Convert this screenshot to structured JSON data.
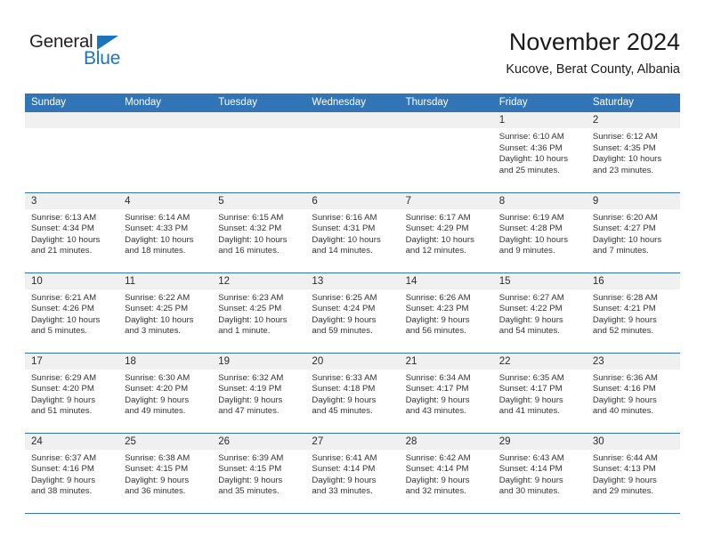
{
  "brand": {
    "name_part1": "General",
    "name_part2": "Blue",
    "accent_color": "#1b75bc"
  },
  "header": {
    "title": "November 2024",
    "subtitle": "Kucove, Berat County, Albania"
  },
  "theme": {
    "header_bg": "#3275b7",
    "daynum_bg": "#f0f0f0",
    "text_color": "#333333"
  },
  "weekdays": [
    "Sunday",
    "Monday",
    "Tuesday",
    "Wednesday",
    "Thursday",
    "Friday",
    "Saturday"
  ],
  "weeks": [
    [
      {
        "day": "",
        "empty": true
      },
      {
        "day": "",
        "empty": true
      },
      {
        "day": "",
        "empty": true
      },
      {
        "day": "",
        "empty": true
      },
      {
        "day": "",
        "empty": true
      },
      {
        "day": "1",
        "sunrise": "Sunrise: 6:10 AM",
        "sunset": "Sunset: 4:36 PM",
        "daylight1": "Daylight: 10 hours",
        "daylight2": "and 25 minutes."
      },
      {
        "day": "2",
        "sunrise": "Sunrise: 6:12 AM",
        "sunset": "Sunset: 4:35 PM",
        "daylight1": "Daylight: 10 hours",
        "daylight2": "and 23 minutes."
      }
    ],
    [
      {
        "day": "3",
        "sunrise": "Sunrise: 6:13 AM",
        "sunset": "Sunset: 4:34 PM",
        "daylight1": "Daylight: 10 hours",
        "daylight2": "and 21 minutes."
      },
      {
        "day": "4",
        "sunrise": "Sunrise: 6:14 AM",
        "sunset": "Sunset: 4:33 PM",
        "daylight1": "Daylight: 10 hours",
        "daylight2": "and 18 minutes."
      },
      {
        "day": "5",
        "sunrise": "Sunrise: 6:15 AM",
        "sunset": "Sunset: 4:32 PM",
        "daylight1": "Daylight: 10 hours",
        "daylight2": "and 16 minutes."
      },
      {
        "day": "6",
        "sunrise": "Sunrise: 6:16 AM",
        "sunset": "Sunset: 4:31 PM",
        "daylight1": "Daylight: 10 hours",
        "daylight2": "and 14 minutes."
      },
      {
        "day": "7",
        "sunrise": "Sunrise: 6:17 AM",
        "sunset": "Sunset: 4:29 PM",
        "daylight1": "Daylight: 10 hours",
        "daylight2": "and 12 minutes."
      },
      {
        "day": "8",
        "sunrise": "Sunrise: 6:19 AM",
        "sunset": "Sunset: 4:28 PM",
        "daylight1": "Daylight: 10 hours",
        "daylight2": "and 9 minutes."
      },
      {
        "day": "9",
        "sunrise": "Sunrise: 6:20 AM",
        "sunset": "Sunset: 4:27 PM",
        "daylight1": "Daylight: 10 hours",
        "daylight2": "and 7 minutes."
      }
    ],
    [
      {
        "day": "10",
        "sunrise": "Sunrise: 6:21 AM",
        "sunset": "Sunset: 4:26 PM",
        "daylight1": "Daylight: 10 hours",
        "daylight2": "and 5 minutes."
      },
      {
        "day": "11",
        "sunrise": "Sunrise: 6:22 AM",
        "sunset": "Sunset: 4:25 PM",
        "daylight1": "Daylight: 10 hours",
        "daylight2": "and 3 minutes."
      },
      {
        "day": "12",
        "sunrise": "Sunrise: 6:23 AM",
        "sunset": "Sunset: 4:25 PM",
        "daylight1": "Daylight: 10 hours",
        "daylight2": "and 1 minute."
      },
      {
        "day": "13",
        "sunrise": "Sunrise: 6:25 AM",
        "sunset": "Sunset: 4:24 PM",
        "daylight1": "Daylight: 9 hours",
        "daylight2": "and 59 minutes."
      },
      {
        "day": "14",
        "sunrise": "Sunrise: 6:26 AM",
        "sunset": "Sunset: 4:23 PM",
        "daylight1": "Daylight: 9 hours",
        "daylight2": "and 56 minutes."
      },
      {
        "day": "15",
        "sunrise": "Sunrise: 6:27 AM",
        "sunset": "Sunset: 4:22 PM",
        "daylight1": "Daylight: 9 hours",
        "daylight2": "and 54 minutes."
      },
      {
        "day": "16",
        "sunrise": "Sunrise: 6:28 AM",
        "sunset": "Sunset: 4:21 PM",
        "daylight1": "Daylight: 9 hours",
        "daylight2": "and 52 minutes."
      }
    ],
    [
      {
        "day": "17",
        "sunrise": "Sunrise: 6:29 AM",
        "sunset": "Sunset: 4:20 PM",
        "daylight1": "Daylight: 9 hours",
        "daylight2": "and 51 minutes."
      },
      {
        "day": "18",
        "sunrise": "Sunrise: 6:30 AM",
        "sunset": "Sunset: 4:20 PM",
        "daylight1": "Daylight: 9 hours",
        "daylight2": "and 49 minutes."
      },
      {
        "day": "19",
        "sunrise": "Sunrise: 6:32 AM",
        "sunset": "Sunset: 4:19 PM",
        "daylight1": "Daylight: 9 hours",
        "daylight2": "and 47 minutes."
      },
      {
        "day": "20",
        "sunrise": "Sunrise: 6:33 AM",
        "sunset": "Sunset: 4:18 PM",
        "daylight1": "Daylight: 9 hours",
        "daylight2": "and 45 minutes."
      },
      {
        "day": "21",
        "sunrise": "Sunrise: 6:34 AM",
        "sunset": "Sunset: 4:17 PM",
        "daylight1": "Daylight: 9 hours",
        "daylight2": "and 43 minutes."
      },
      {
        "day": "22",
        "sunrise": "Sunrise: 6:35 AM",
        "sunset": "Sunset: 4:17 PM",
        "daylight1": "Daylight: 9 hours",
        "daylight2": "and 41 minutes."
      },
      {
        "day": "23",
        "sunrise": "Sunrise: 6:36 AM",
        "sunset": "Sunset: 4:16 PM",
        "daylight1": "Daylight: 9 hours",
        "daylight2": "and 40 minutes."
      }
    ],
    [
      {
        "day": "24",
        "sunrise": "Sunrise: 6:37 AM",
        "sunset": "Sunset: 4:16 PM",
        "daylight1": "Daylight: 9 hours",
        "daylight2": "and 38 minutes."
      },
      {
        "day": "25",
        "sunrise": "Sunrise: 6:38 AM",
        "sunset": "Sunset: 4:15 PM",
        "daylight1": "Daylight: 9 hours",
        "daylight2": "and 36 minutes."
      },
      {
        "day": "26",
        "sunrise": "Sunrise: 6:39 AM",
        "sunset": "Sunset: 4:15 PM",
        "daylight1": "Daylight: 9 hours",
        "daylight2": "and 35 minutes."
      },
      {
        "day": "27",
        "sunrise": "Sunrise: 6:41 AM",
        "sunset": "Sunset: 4:14 PM",
        "daylight1": "Daylight: 9 hours",
        "daylight2": "and 33 minutes."
      },
      {
        "day": "28",
        "sunrise": "Sunrise: 6:42 AM",
        "sunset": "Sunset: 4:14 PM",
        "daylight1": "Daylight: 9 hours",
        "daylight2": "and 32 minutes."
      },
      {
        "day": "29",
        "sunrise": "Sunrise: 6:43 AM",
        "sunset": "Sunset: 4:14 PM",
        "daylight1": "Daylight: 9 hours",
        "daylight2": "and 30 minutes."
      },
      {
        "day": "30",
        "sunrise": "Sunrise: 6:44 AM",
        "sunset": "Sunset: 4:13 PM",
        "daylight1": "Daylight: 9 hours",
        "daylight2": "and 29 minutes."
      }
    ]
  ]
}
